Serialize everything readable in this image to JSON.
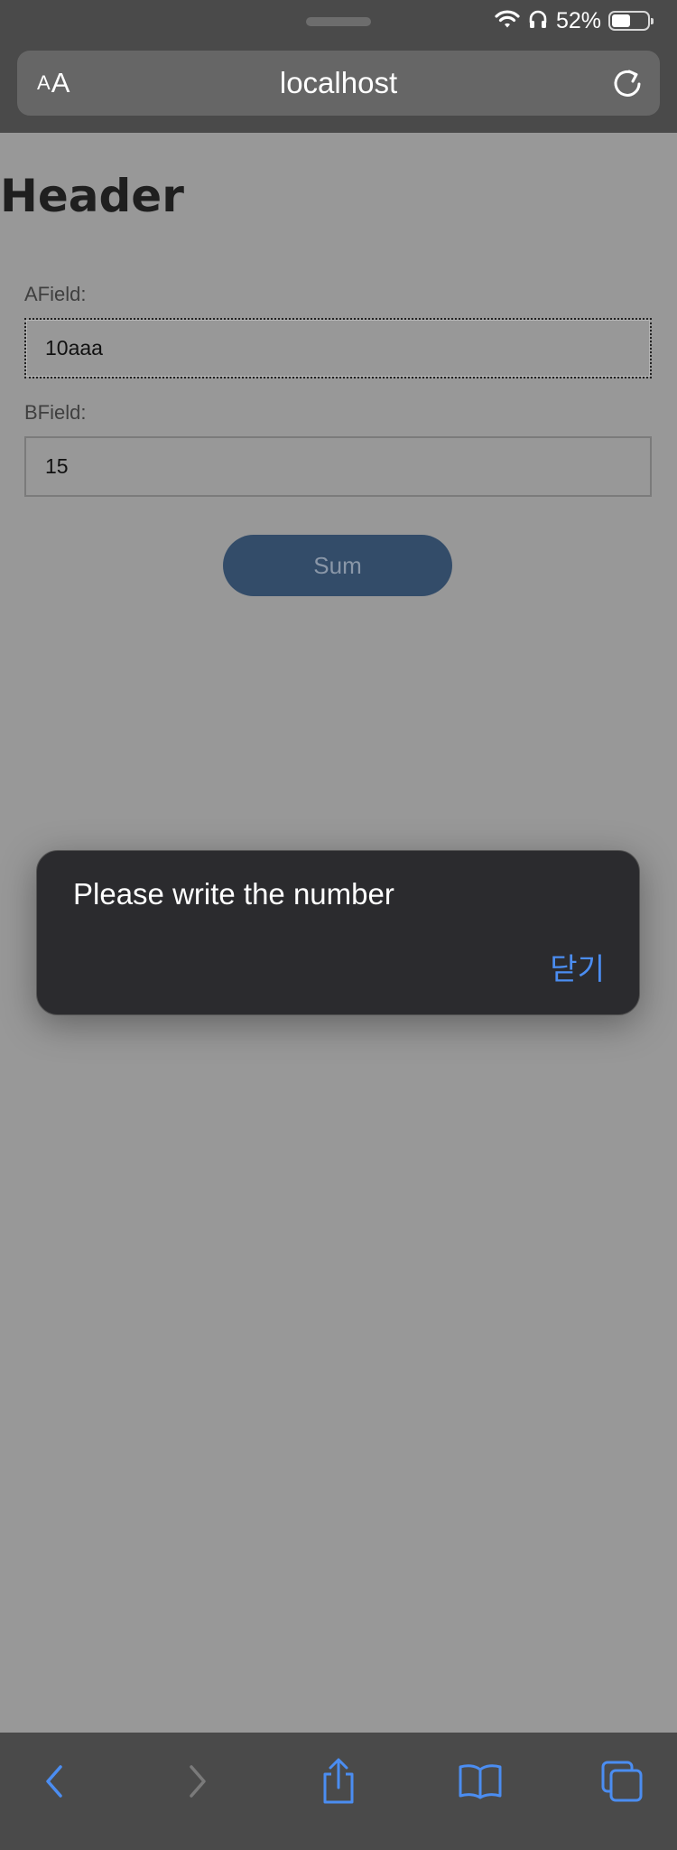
{
  "status_bar": {
    "battery_percent_text": "52%",
    "battery_level": 0.52,
    "icons": [
      "wifi-icon",
      "headphones-icon",
      "battery-icon"
    ]
  },
  "address_bar": {
    "text_size_small": "A",
    "text_size_large": "A",
    "url": "localhost",
    "icons": [
      "reload-icon"
    ]
  },
  "page": {
    "header": "Header",
    "a_field": {
      "label": "AField:",
      "value": "10aaa"
    },
    "b_field": {
      "label": "BField:",
      "value": "15"
    },
    "sum_button_label": "Sum"
  },
  "alert": {
    "message": "Please write the number",
    "close_label": "닫기"
  },
  "toolbar": {
    "icons": [
      "back-icon",
      "forward-icon",
      "share-icon",
      "bookmarks-icon",
      "tabs-icon"
    ]
  },
  "colors": {
    "chrome_background": "#4a4a4a",
    "page_dim_background": "#989898",
    "accent_blue": "#4b8df1",
    "sum_button_background": "#334c69",
    "alert_background": "#2b2b2e"
  }
}
